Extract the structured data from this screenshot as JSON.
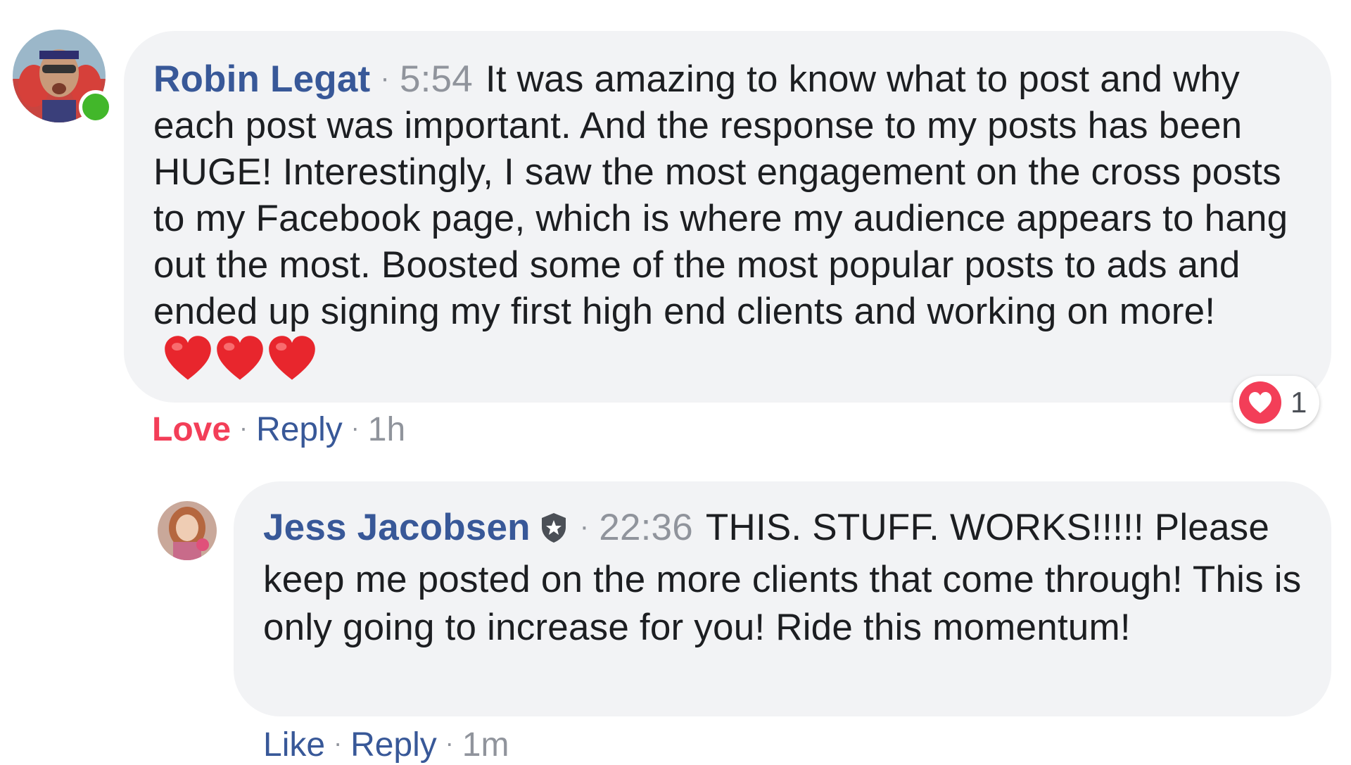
{
  "comments": [
    {
      "author": "Robin Legat",
      "timestamp": "5:54",
      "text": "It was amazing to know what to post and why each post was important. And the response to my posts has been HUGE! Interestingly, I saw the most engagement on the cross posts to my Facebook page, which is where my audience appears to hang out the most. Boosted some of the most popular posts to ads and ended up signing my first high end clients and working on more!",
      "emoji": [
        "heart-emoji",
        "heart-emoji",
        "heart-emoji"
      ],
      "online": true,
      "reaction_icon": "love-reaction-icon",
      "reaction_count": "1",
      "actions": {
        "like_label": "Love",
        "reply_label": "Reply",
        "age": "1h"
      }
    },
    {
      "author": "Jess Jacobsen",
      "verified_icon": "verified-badge-icon",
      "timestamp": "22:36",
      "text": "THIS. STUFF. WORKS!!!!! Please keep me posted on the more clients that come through! This is only going to increase for you! Ride this momentum!",
      "actions": {
        "like_label": "Like",
        "reply_label": "Reply",
        "age": "1m"
      }
    }
  ],
  "colors": {
    "author": "#385898",
    "bubble": "#f2f3f5",
    "meta": "#90949c",
    "love": "#f33e58",
    "online": "#42b72a"
  }
}
